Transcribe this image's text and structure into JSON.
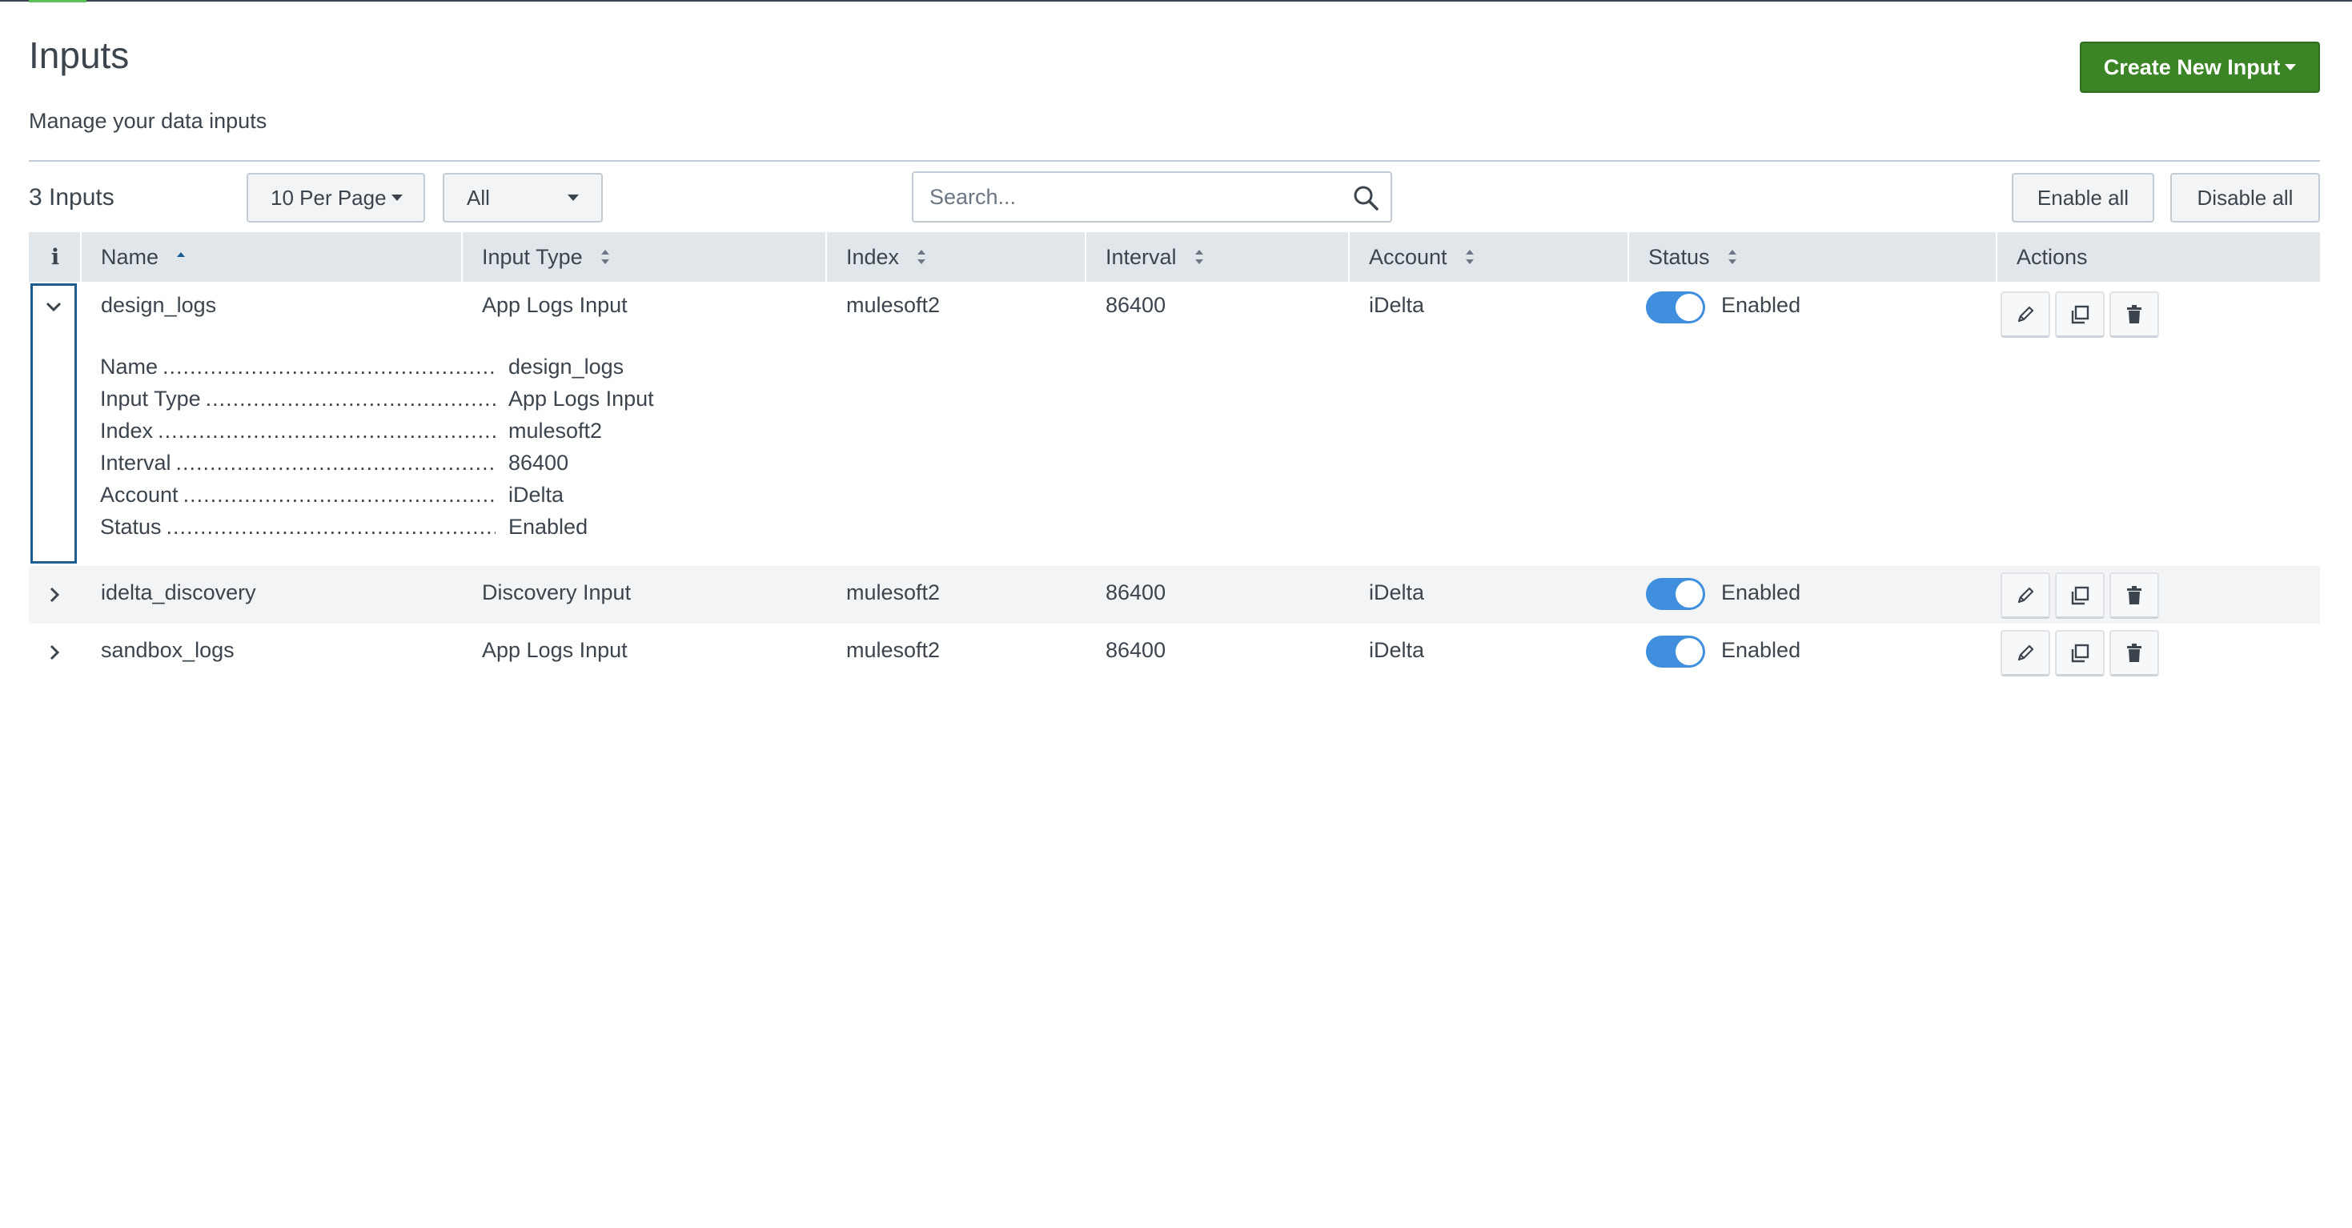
{
  "page": {
    "title": "Inputs",
    "subtitle": "Manage your data inputs",
    "create_button": "Create New Input"
  },
  "toolbar": {
    "count": "3 Inputs",
    "per_page": "10 Per Page",
    "type_filter": "All",
    "search_placeholder": "Search...",
    "enable_all": "Enable all",
    "disable_all": "Disable all"
  },
  "table": {
    "info_header": "i",
    "columns": [
      "Name",
      "Input Type",
      "Index",
      "Interval",
      "Account",
      "Status",
      "Actions"
    ],
    "sorted_column": "Name",
    "sort_direction": "ascending",
    "rows": [
      {
        "name": "design_logs",
        "input_type": "App Logs Input",
        "index": "mulesoft2",
        "interval": "86400",
        "account": "iDelta",
        "status": "Enabled",
        "enabled": true,
        "expanded": true
      },
      {
        "name": "idelta_discovery",
        "input_type": "Discovery Input",
        "index": "mulesoft2",
        "interval": "86400",
        "account": "iDelta",
        "status": "Enabled",
        "enabled": true,
        "expanded": false
      },
      {
        "name": "sandbox_logs",
        "input_type": "App Logs Input",
        "index": "mulesoft2",
        "interval": "86400",
        "account": "iDelta",
        "status": "Enabled",
        "enabled": true,
        "expanded": false
      }
    ],
    "details": [
      {
        "label": "Name",
        "value": "design_logs"
      },
      {
        "label": "Input Type",
        "value": "App Logs Input"
      },
      {
        "label": "Index",
        "value": "mulesoft2"
      },
      {
        "label": "Interval",
        "value": "86400"
      },
      {
        "label": "Account",
        "value": "iDelta"
      },
      {
        "label": "Status",
        "value": "Enabled"
      }
    ]
  },
  "colors": {
    "primary_button": "#3c8527",
    "toggle_on": "#3f8fde",
    "header_bg": "#e1e6eb",
    "focus_border": "#1d5c8f"
  },
  "icons": [
    "chevron-down-icon",
    "chevron-right-icon",
    "search-icon",
    "sort-icon",
    "edit-icon",
    "clone-icon",
    "delete-icon"
  ]
}
